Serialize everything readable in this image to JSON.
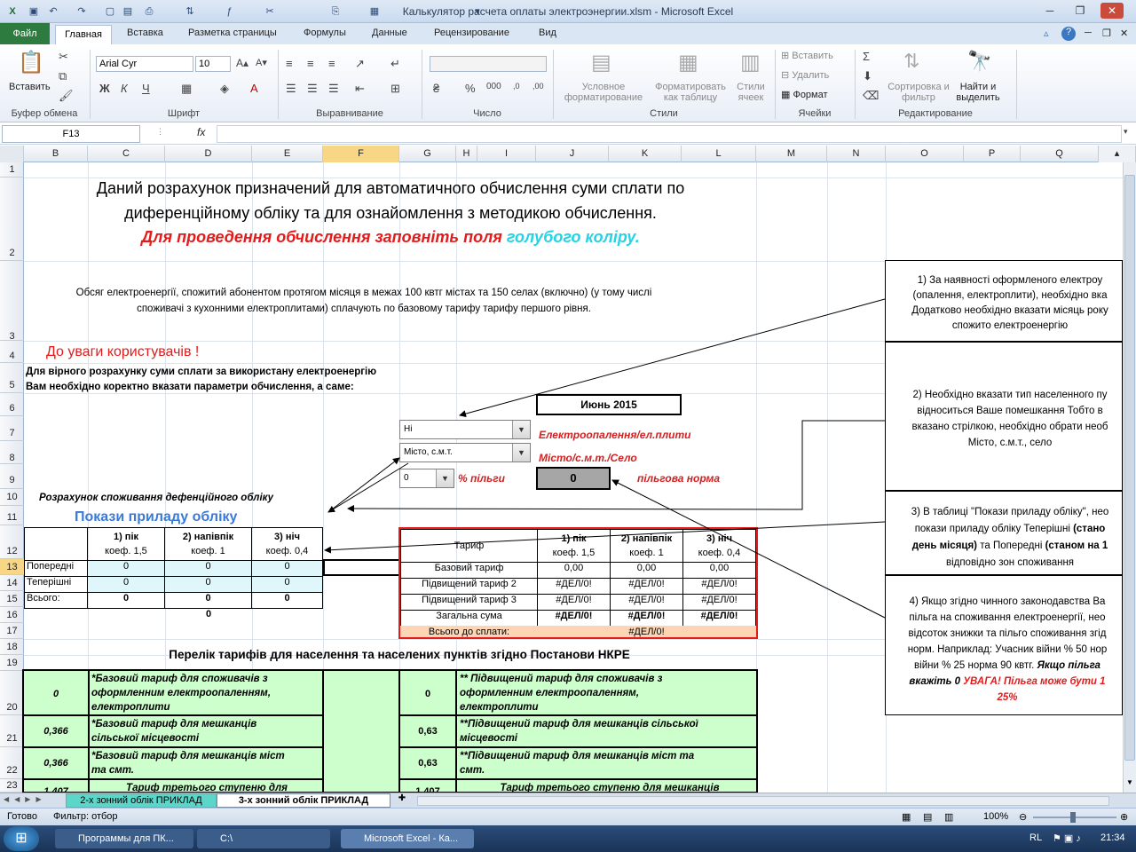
{
  "window": {
    "title": "Калькулятор расчета оплаты электроэнергии.xlsm  -  Microsoft Excel"
  },
  "tabs": {
    "file": "Файл",
    "home": "Главная",
    "insert": "Вставка",
    "layout": "Разметка страницы",
    "formulas": "Формулы",
    "data": "Данные",
    "review": "Рецензирование",
    "view": "Вид"
  },
  "ribbon": {
    "paste": "Вставить",
    "clipboard": "Буфер обмена",
    "font_name": "Arial Cyr",
    "font_size": "10",
    "font_group": "Шрифт",
    "align_group": "Выравнивание",
    "number_group": "Число",
    "cond_format": "Условное форматирование",
    "format_table": "Форматировать как таблицу",
    "cell_styles": "Стили ячеек",
    "styles_group": "Стили",
    "insert": "Вставить",
    "delete": "Удалить",
    "format": "Формат",
    "cells_group": "Ячейки",
    "sort": "Сортировка и фильтр",
    "find": "Найти и выделить",
    "editing_group": "Редактирование"
  },
  "formula_bar": {
    "name_box": "F13",
    "fx": "fx",
    "value": ""
  },
  "columns": [
    "B",
    "C",
    "D",
    "E",
    "F",
    "G",
    "H",
    "I",
    "J",
    "K",
    "L",
    "M",
    "N",
    "O",
    "P",
    "Q"
  ],
  "rows": [
    "1",
    "2",
    "3",
    "4",
    "5",
    "6",
    "7",
    "8",
    "9",
    "10",
    "11",
    "12",
    "13",
    "14",
    "15",
    "16",
    "17",
    "18",
    "19",
    "20",
    "21",
    "22",
    "23"
  ],
  "sheet": {
    "title1": "Даний розрахунок призначений для автоматичного обчислення суми сплати по",
    "title2": "диференційному обліку та для ознайомлення з методикою обчислення.",
    "title3a": "Для проведення обчислення заповніть поля ",
    "title3b": "голубого коліру.",
    "info1": "Обсяг електроенергії, спожитий абонентом протягом місяця в межах 100 квтг містах та 150 селах (включно) (у тому числі",
    "info2": "споживачі з кухонними електроплитами) сплачують по базовому тарифу тарифу першого рівня.",
    "attention": "До уваги користувачів !",
    "instr1": "Для вірного розрахунку суми сплати за використану електроенергію",
    "instr2": "Вам необхідно коректно вказати параметри обчислення, а саме:",
    "month": "Июнь 2015",
    "dd_heating": "Ні",
    "lbl_heating": "Електроопалення/ел.плити",
    "dd_location": "Місто, с.м.т.",
    "lbl_location": "Місто/с.м.т./Село",
    "dd_discount": "0",
    "lbl_discount": "% пільги",
    "norm_value": "0",
    "lbl_norm": "пільгова норма",
    "calc_label": "Розрахунок споживання дефенційного обліку",
    "meter_title": "Покази приладу обліку",
    "meter": {
      "h1a": "1) пік",
      "h1b": "коеф. 1,5",
      "h2a": "2) напівпік",
      "h2b": "коеф. 1",
      "h3a": "3) ніч",
      "h3b": "коеф. 0,4",
      "rows": [
        {
          "label": "Попередні",
          "v": [
            "0",
            "0",
            "0"
          ]
        },
        {
          "label": "Теперішні",
          "v": [
            "0",
            "0",
            "0"
          ]
        },
        {
          "label": "Всього:",
          "v": [
            "0",
            "0",
            "0"
          ]
        }
      ],
      "total": "0"
    },
    "tariff": {
      "header": "Тариф",
      "h1a": "1) пік",
      "h1b": "коеф. 1,5",
      "h2a": "2) напівпік",
      "h2b": "коеф. 1",
      "h3a": "3) ніч",
      "h3b": "коеф. 0,4",
      "rows": [
        {
          "label": "Базовий тариф",
          "v": [
            "0,00",
            "0,00",
            "0,00"
          ]
        },
        {
          "label": "Підвищений тариф 2",
          "v": [
            "#ДЕЛ/0!",
            "#ДЕЛ/0!",
            "#ДЕЛ/0!"
          ]
        },
        {
          "label": "Підвищений тариф 3",
          "v": [
            "#ДЕЛ/0!",
            "#ДЕЛ/0!",
            "#ДЕЛ/0!"
          ]
        },
        {
          "label": "Загальна сума",
          "v": [
            "#ДЕЛ/0!",
            "#ДЕЛ/0!",
            "#ДЕЛ/0!"
          ]
        }
      ],
      "total_label": "Всього до сплати:",
      "total_value": "#ДЕЛ/0!"
    },
    "list_title": "Перелік тарифів для населення та населених пунктів згідно Постанови НКРЕ",
    "list": [
      {
        "v1": "0",
        "t1a": "*Базовий тариф для споживачів з",
        "t1b": "оформленним електроопаленням,",
        "t1c": "електроплити",
        "v2": "0",
        "t2a": "** Підвищений тариф для споживачів з",
        "t2b": "оформленним електроопаленням,",
        "t2c": "електроплити"
      },
      {
        "v1": "0,366",
        "t1a": "*Базовий тариф для мешканців",
        "t1b": "сільської місцевості",
        "t1c": "",
        "v2": "0,63",
        "t2a": "**Підвищений тариф для мешканців сільської",
        "t2b": "місцевості",
        "t2c": ""
      },
      {
        "v1": "0,366",
        "t1a": "*Базовий тариф для мешканців міст",
        "t1b": "та смт.",
        "t1c": "",
        "v2": "0,63",
        "t2a": "**Підвищений тариф для мешканців міст та",
        "t2b": "смт.",
        "t2c": ""
      },
      {
        "v1": "1,407",
        "t1a": "Тариф третього ступеню для",
        "t1b": "",
        "t1c": "",
        "v2": "1,407",
        "t2a": "Тариф третього ступеню для мешканців",
        "t2b": "",
        "t2c": ""
      }
    ],
    "note1a": "1) За наявності оформленого електроу",
    "note1b": "(опалення, електроплити), необхідно вка",
    "note1c": "Додатково необхідно вказати місяць року",
    "note1d": "спожито електроенергію",
    "note2a": "2) Необхідно вказати тип населенного пу",
    "note2b": "відноситься Ваше помешкання Тобто в",
    "note2c": "вказано стрілкою, необхідно обрати необ",
    "note2d": "Місто, с.м.т., село",
    "note3a": "3) В таблиці \"Покази приладу обліку\", нео",
    "note3b": "покази приладу обліку Теперішні",
    "note3bb": " (стано",
    "note3c": "день місяця)",
    "note3cc": " та Попередні ",
    "note3cd": "(станом на 1",
    "note3d": "відповідно зон споживання",
    "note4a": "4) Якщо згідно чинного законодавства Ва",
    "note4b": "пільга на споживання електроенергії, нео",
    "note4c": "відсоток знижки та пільго споживання згід",
    "note4d": "норм. Наприклад: Учасник війни % 50 нор",
    "note4e": "війни % 25 норма 90 квтг. ",
    "note4ee": "Якщо пільга",
    "note4f": "вкажіть 0 ",
    "note4ff": " УВАГА! Пільга може бути 1",
    "note4g": "25%"
  },
  "sheet_tabs": [
    {
      "label": "2-х зонний облік ПРИКЛАД"
    },
    {
      "label": "3-х зонний облік ПРИКЛАД"
    }
  ],
  "status": {
    "ready": "Готово",
    "filter": "Фильтр: отбор",
    "zoom": "100%"
  },
  "taskbar": {
    "t1": "Программы для ПК...",
    "t2": "C:\\",
    "t3": "Microsoft Excel - Ка...",
    "lang": "RL",
    "time": "21:34"
  },
  "colors": {
    "accent_blue": "#00b0f0",
    "error_red": "#e31b1b",
    "light_blue": "#dff6fa",
    "light_green": "#ccffcc",
    "orange": "#fcd5b4"
  }
}
